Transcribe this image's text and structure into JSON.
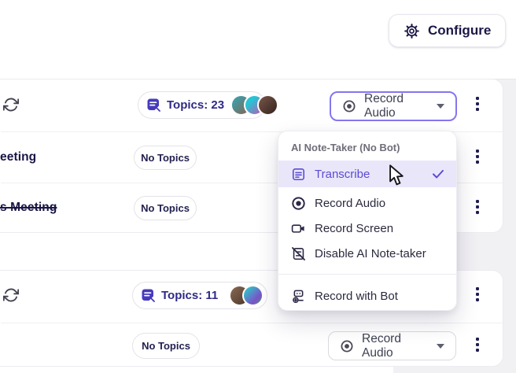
{
  "header": {
    "configure": {
      "label": "Configure",
      "icon": "gear-icon"
    }
  },
  "dropdown_menu": {
    "section_label": "AI Note-Taker (No Bot)",
    "items": [
      {
        "label": "Transcribe",
        "icon": "transcribe-icon",
        "selected": true
      },
      {
        "label": "Record Audio",
        "icon": "record-audio-icon",
        "selected": false
      },
      {
        "label": "Record Screen",
        "icon": "record-screen-icon",
        "selected": false
      },
      {
        "label": "Disable AI Note-taker",
        "icon": "disable-ai-note-taker-icon",
        "selected": false
      }
    ],
    "footer_items": [
      {
        "label": "Record with Bot",
        "icon": "record-with-bot-icon",
        "selected": false
      }
    ]
  },
  "rows": [
    {
      "recurring": true,
      "badge": "Topics: 23",
      "avatar_count": 3,
      "button_label": "Record Audio",
      "focused": true
    },
    {
      "title": "eeting",
      "badge": "No Topics"
    },
    {
      "title": "s Meeting",
      "cancelled": true,
      "badge": "No Topics"
    },
    {
      "recurring": true,
      "badge": "Topics: 11",
      "avatar_count": 2
    },
    {
      "badge": "No Topics",
      "button_label": "Record Audio"
    }
  ],
  "colors": {
    "accent_purple": "#5a4bd4",
    "menu_highlight": "#e9e6fa",
    "badge_text": "#2e2a86",
    "dark_navy": "#1b1747",
    "focus_ring": "#8476f0",
    "page_gray": "#f1f1f4"
  }
}
